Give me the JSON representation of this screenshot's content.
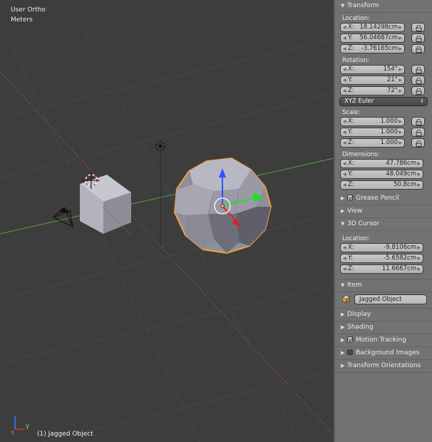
{
  "viewport": {
    "view_name": "User Ortho",
    "units": "Meters",
    "active_object": "(1) Jagged Object",
    "axis_x": "x",
    "axis_y": "y"
  },
  "panel": {
    "transform": {
      "title": "Transform",
      "location_label": "Location:",
      "location": [
        {
          "axis": "X:",
          "value": "18.14298cm"
        },
        {
          "axis": "Y:",
          "value": "56.04687cm"
        },
        {
          "axis": "Z:",
          "value": "-3.76165cm"
        }
      ],
      "rotation_label": "Rotation:",
      "rotation": [
        {
          "axis": "X:",
          "value": "154°"
        },
        {
          "axis": "Y:",
          "value": "21°"
        },
        {
          "axis": "Z:",
          "value": "72°"
        }
      ],
      "rotation_mode": "XYZ Euler",
      "scale_label": "Scale:",
      "scale": [
        {
          "axis": "X:",
          "value": "1.000"
        },
        {
          "axis": "Y:",
          "value": "1.000"
        },
        {
          "axis": "Z:",
          "value": "1.000"
        }
      ],
      "dimensions_label": "Dimensions:",
      "dimensions": [
        {
          "axis": "X:",
          "value": "47.786cm"
        },
        {
          "axis": "Y:",
          "value": "48.049cm"
        },
        {
          "axis": "Z:",
          "value": "50.8cm"
        }
      ]
    },
    "grease_pencil": "Grease Pencil",
    "view": "View",
    "cursor": {
      "title": "3D Cursor",
      "location_label": "Location:",
      "location": [
        {
          "axis": "X:",
          "value": "-9.8106cm"
        },
        {
          "axis": "Y:",
          "value": "-5.6582cm"
        },
        {
          "axis": "Z:",
          "value": "11.6667cm"
        }
      ]
    },
    "item": {
      "title": "Item",
      "object_name": "Jagged Object"
    },
    "display": "Display",
    "shading": "Shading",
    "motion_tracking": "Motion Tracking",
    "background_images": "Background Images",
    "transform_orientations": "Transform Orientations"
  },
  "colors": {
    "selection_outline": "#f0a040",
    "x_axis": "#c04040",
    "y_axis": "#50a040",
    "manip_z": "#3050ff",
    "manip_y": "#20e020",
    "manip_x": "#e02020"
  }
}
